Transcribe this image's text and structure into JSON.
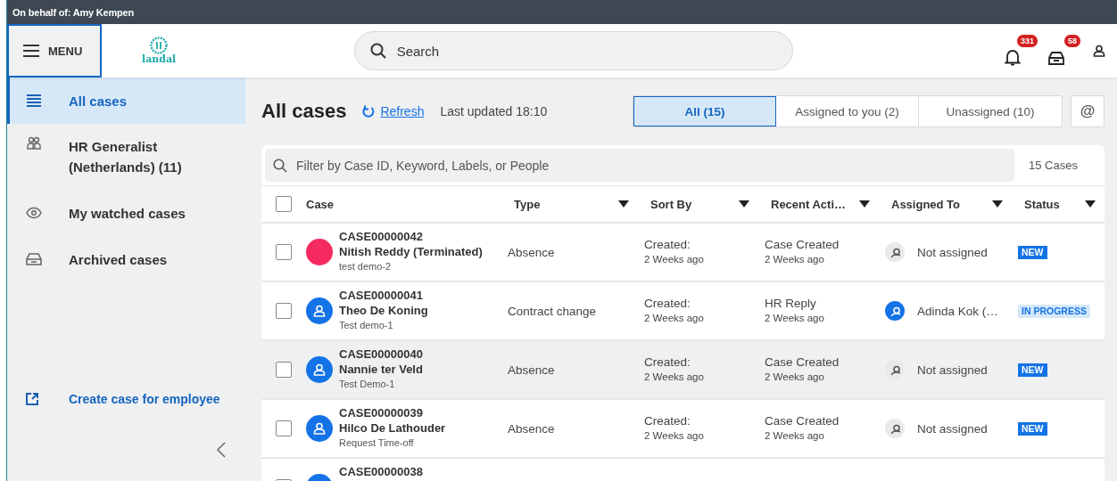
{
  "banner": {
    "text": "On behalf of: Amy Kempen"
  },
  "header": {
    "menu_label": "MENU",
    "logo_text": "landal",
    "search_placeholder": "Search",
    "notification_count": "331",
    "inbox_count": "58"
  },
  "sidebar": {
    "items": [
      {
        "label": "All cases",
        "kind": "list",
        "selected": true
      },
      {
        "label": "HR Generalist (Netherlands) (11)",
        "kind": "group",
        "selected": false
      },
      {
        "label": "My watched cases",
        "kind": "watch",
        "selected": false
      },
      {
        "label": "Archived cases",
        "kind": "archive",
        "selected": false
      }
    ],
    "action": {
      "label": "Create case for employee"
    }
  },
  "main": {
    "title": "All cases",
    "refresh": "Refresh",
    "last_updated": "Last updated 18:10",
    "tabs": [
      {
        "label": "All (15)",
        "selected": true
      },
      {
        "label": "Assigned to you (2)",
        "selected": false
      },
      {
        "label": "Unassigned (10)",
        "selected": false
      }
    ],
    "mention_button": "@"
  },
  "table": {
    "filter_placeholder": "Filter by Case ID, Keyword, Labels, or People",
    "count": "15 Cases",
    "select_all_checked": false,
    "columns": [
      {
        "label": "Case",
        "menu": false
      },
      {
        "label": "Type",
        "menu": true
      },
      {
        "label": "Sort By",
        "menu": true
      },
      {
        "label": "Recent Acti…",
        "menu": true
      },
      {
        "label": "Assigned To",
        "menu": true
      },
      {
        "label": "Status",
        "menu": true
      }
    ],
    "rows": [
      {
        "checked": false,
        "hovered": false,
        "avatar": {
          "kind": "blank",
          "color": "#f52a5e"
        },
        "case_id": "CASE00000042",
        "name": "Nitish Reddy (Terminated)",
        "description": "test demo-2",
        "type": "Absence",
        "sort_label": "Created:",
        "sort_value": "2 Weeks ago",
        "recent_action": "Case Created",
        "recent_time": "2 Weeks ago",
        "assignee": {
          "name": "Not assigned",
          "kind": "none"
        },
        "status": {
          "label": "NEW",
          "kind": "new"
        }
      },
      {
        "checked": false,
        "hovered": false,
        "avatar": {
          "kind": "person",
          "color": "#1473e6"
        },
        "case_id": "CASE00000041",
        "name": "Theo De Koning",
        "description": "Test demo-1",
        "type": "Contract change",
        "sort_label": "Created:",
        "sort_value": "2 Weeks ago",
        "recent_action": "HR Reply",
        "recent_time": "2 Weeks ago",
        "assignee": {
          "name": "Adinda Kok (…",
          "kind": "person"
        },
        "status": {
          "label": "IN PROGRESS",
          "kind": "in_progress"
        }
      },
      {
        "checked": false,
        "hovered": true,
        "avatar": {
          "kind": "person",
          "color": "#1473e6"
        },
        "case_id": "CASE00000040",
        "name": "Nannie ter Veld",
        "description": "Test Demo-1",
        "type": "Absence",
        "sort_label": "Created:",
        "sort_value": "2 Weeks ago",
        "recent_action": "Case Created",
        "recent_time": "2 Weeks ago",
        "assignee": {
          "name": "Not assigned",
          "kind": "none"
        },
        "status": {
          "label": "NEW",
          "kind": "new"
        }
      },
      {
        "checked": false,
        "hovered": false,
        "avatar": {
          "kind": "person",
          "color": "#1473e6"
        },
        "case_id": "CASE00000039",
        "name": "Hilco De Lathouder",
        "description": "Request Time-off",
        "type": "Absence",
        "sort_label": "Created:",
        "sort_value": "2 Weeks ago",
        "recent_action": "Case Created",
        "recent_time": "2 Weeks ago",
        "assignee": {
          "name": "Not assigned",
          "kind": "none"
        },
        "status": {
          "label": "NEW",
          "kind": "new"
        }
      },
      {
        "checked": false,
        "hovered": false,
        "avatar": {
          "kind": "person",
          "color": "#1473e6"
        },
        "case_id": "CASE00000038"
      }
    ]
  }
}
